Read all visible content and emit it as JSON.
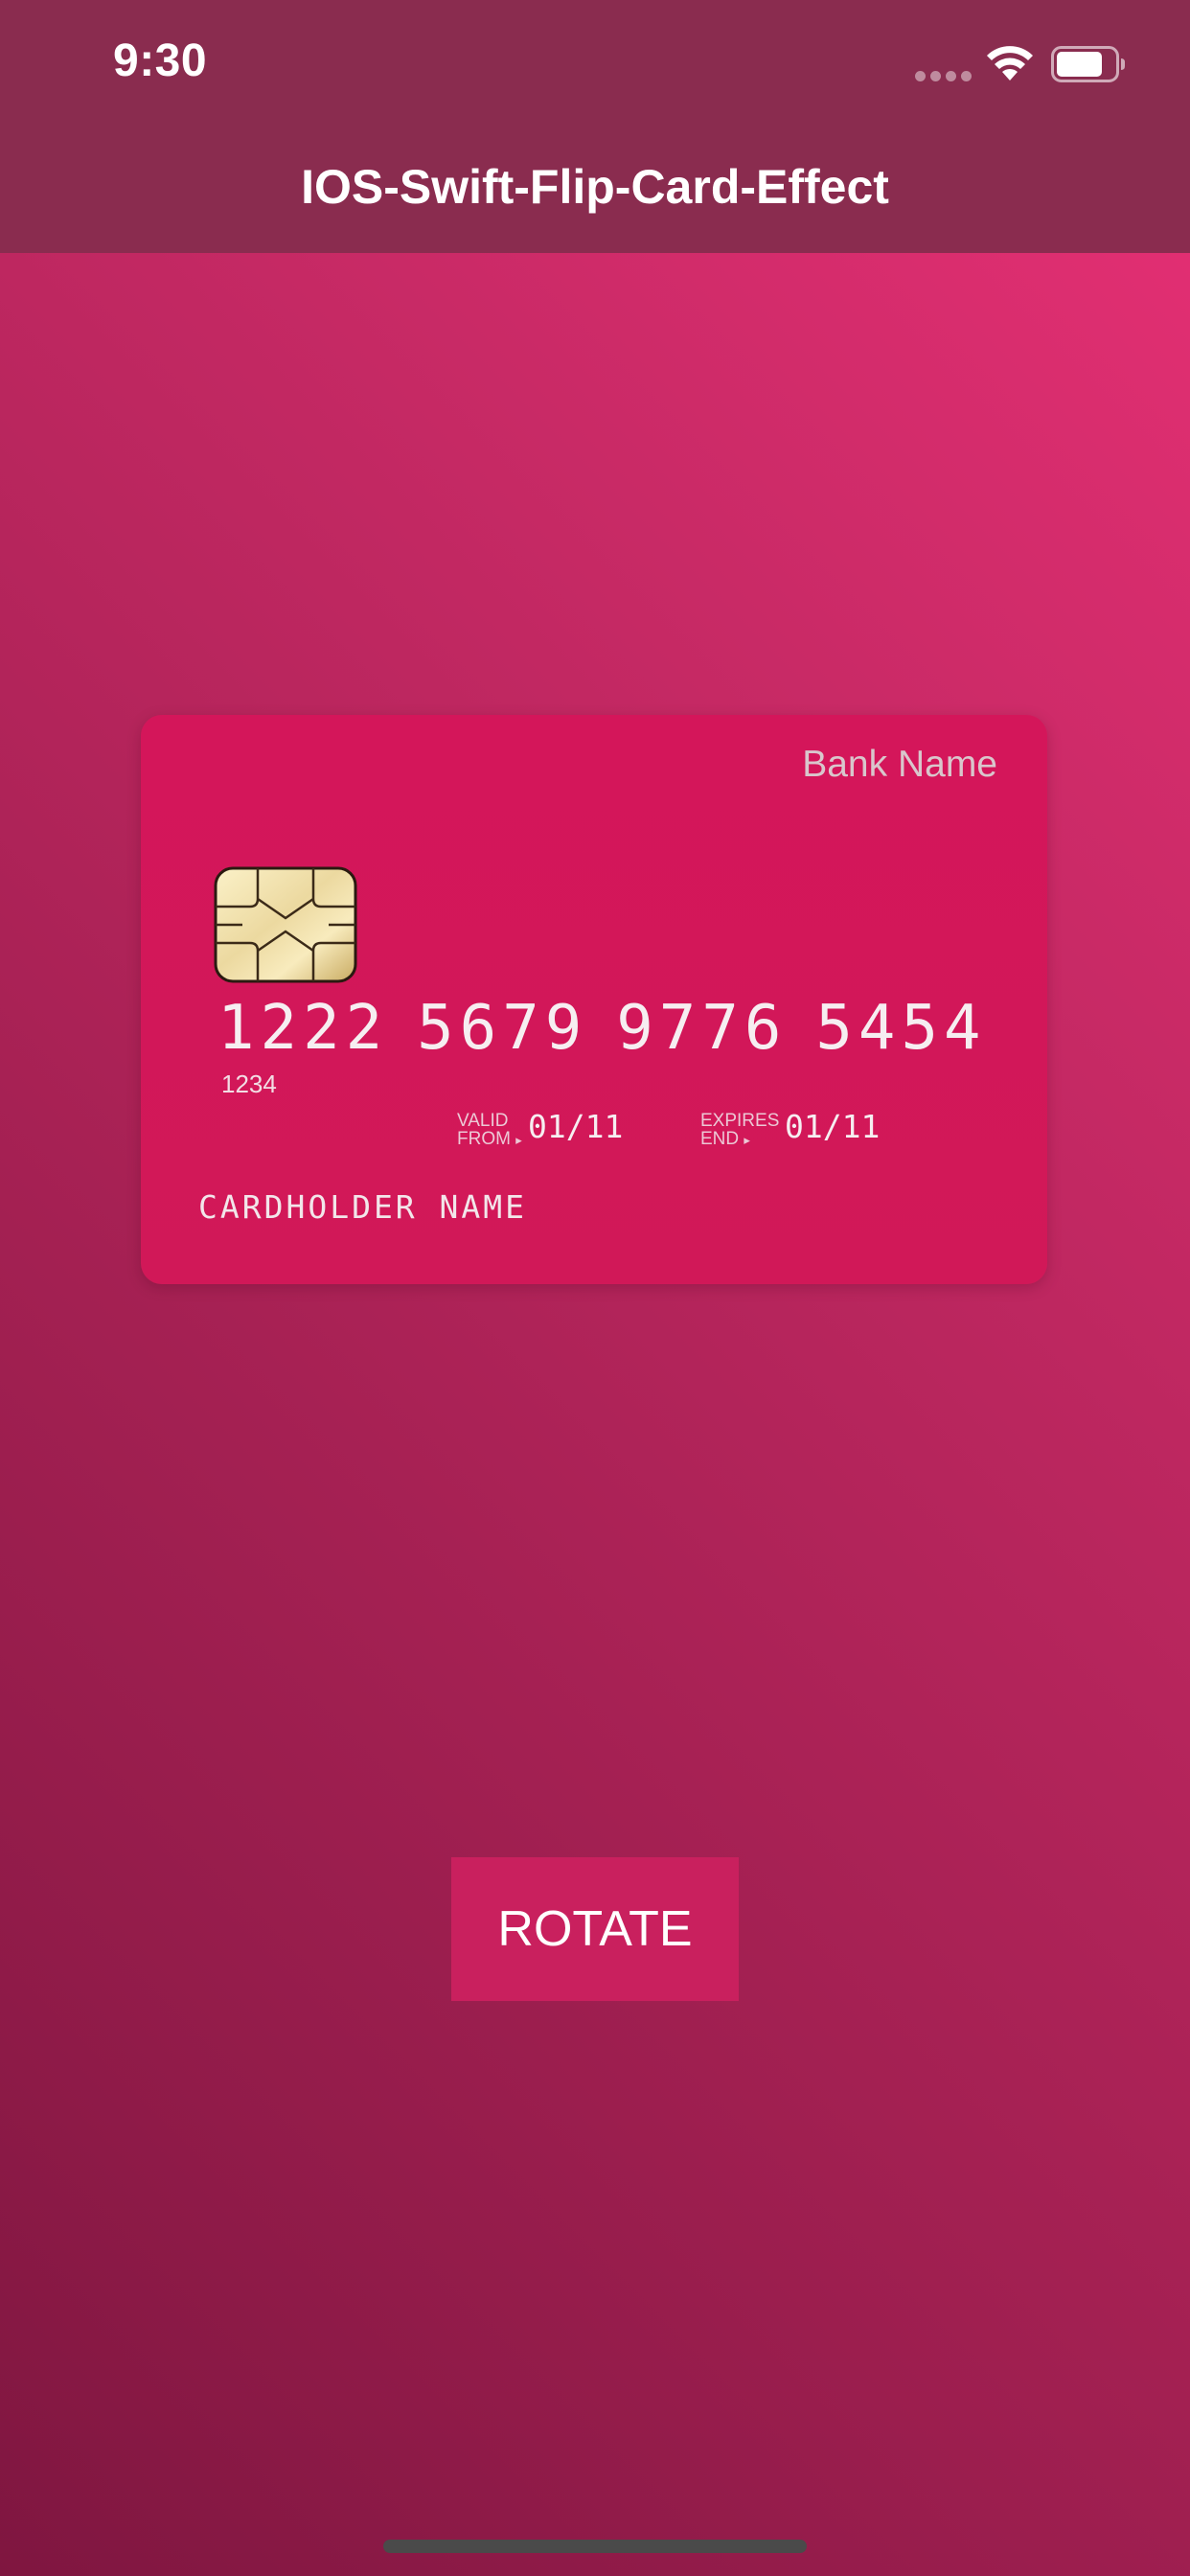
{
  "status_bar": {
    "time": "9:30"
  },
  "nav": {
    "title": "IOS-Swift-Flip-Card-Effect"
  },
  "card": {
    "bank_name": "Bank Name",
    "number_groups": [
      "1222",
      "5679",
      "9776",
      "5454"
    ],
    "sub_number": "1234",
    "valid_from_label_line1": "VALID",
    "valid_from_label_line2": "FROM",
    "valid_from_value": "01/11",
    "expires_label_line1": "EXPIRES",
    "expires_label_line2": "END",
    "expires_value": "01/11",
    "holder_name": "CARDHOLDER NAME"
  },
  "actions": {
    "rotate_label": "ROTATE"
  },
  "colors": {
    "nav_background": "#8a2c4f",
    "card_background": "#d4165a",
    "button_background": "#c9205e"
  }
}
